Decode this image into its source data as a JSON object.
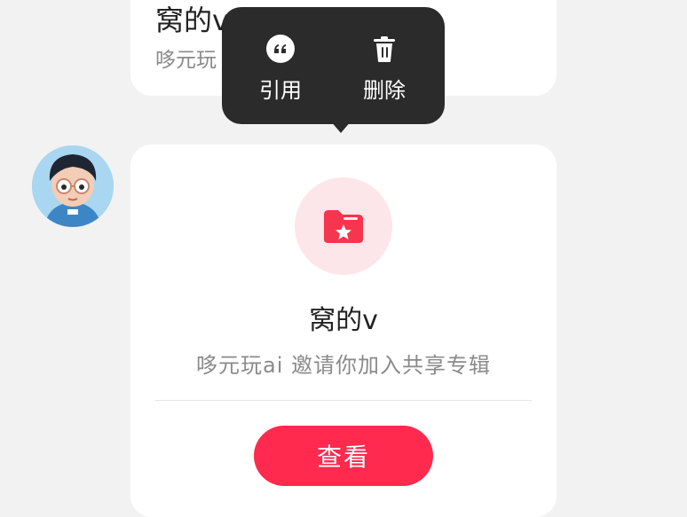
{
  "previous_message": {
    "title": "窝的v",
    "subtitle": "哆元玩"
  },
  "context_menu": {
    "items": [
      {
        "label": "引用",
        "icon": "quote-icon"
      },
      {
        "label": "删除",
        "icon": "trash-icon"
      }
    ]
  },
  "share_card": {
    "icon": "folder-star-icon",
    "album_name": "窝的v",
    "invite_text": "哆元玩ai 邀请你加入共享专辑",
    "view_button_label": "查看"
  },
  "colors": {
    "accent": "#ff2a4d",
    "menu_bg": "#2b2b2b",
    "background": "#f2f2f2"
  }
}
